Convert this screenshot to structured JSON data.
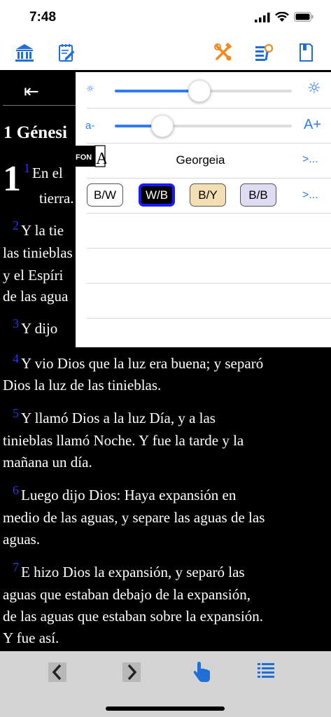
{
  "status": {
    "time": "7:48"
  },
  "toolbar": {
    "icons": [
      "library-icon",
      "notes-icon",
      "tools-icon",
      "search-text-icon",
      "bookmark-icon"
    ],
    "accent_blue": "#1f6fd6",
    "accent_orange": "#f08a1e"
  },
  "reader": {
    "back_glyph": "⇤",
    "book_title": "1 Génesi",
    "chapter_number": "1",
    "verses": [
      {
        "num": "1",
        "lines": [
          "En el",
          "tierra."
        ]
      },
      {
        "num": "2",
        "lines": [
          "Y la tie",
          "las tinieblas",
          "y el Espíri",
          "de las agua"
        ]
      },
      {
        "num": "3",
        "lines": [
          "Y dijo"
        ]
      },
      {
        "num": "4",
        "lines": [
          "Y vio Dios que la luz era buena; y separó",
          "Dios la luz de las tinieblas."
        ]
      },
      {
        "num": "5",
        "lines": [
          "Y llamó Dios a la luz Día, y a las",
          "tinieblas llamó Noche. Y fue la tarde y la",
          "mañana un día."
        ]
      },
      {
        "num": "6",
        "lines": [
          "Luego dijo Dios: Haya expansión en",
          "medio de las aguas, y separe las aguas de las",
          "aguas."
        ]
      },
      {
        "num": "7",
        "lines": [
          "E hizo Dios la expansión, y separó las",
          "aguas que estaban debajo de la expansión,",
          "de las aguas que estaban sobre la expansión.",
          "Y fue así."
        ]
      }
    ]
  },
  "settings": {
    "brightness": 0.48,
    "font_size": 0.27,
    "brightness_small_icon": "☼",
    "brightness_big_icon": "☼",
    "font_small_label": "a-",
    "font_big_label": "A+",
    "font_icon_text": "FON",
    "font_icon_letter": "A",
    "font_name": "Georgeia",
    "more_label": ">...",
    "themes": [
      {
        "label": "B/W",
        "bg": "#ffffff",
        "fg": "#000000",
        "border": "#555555"
      },
      {
        "label": "W/B",
        "bg": "#000000",
        "fg": "#ffffff",
        "border": "#1a1aff"
      },
      {
        "label": "B/Y",
        "bg": "#f4deb3",
        "fg": "#000000",
        "border": "#555555"
      },
      {
        "label": "B/B",
        "bg": "#dedcf3",
        "fg": "#000000",
        "border": "#555555"
      }
    ],
    "theme_more_label": ">..."
  },
  "bottom": {
    "icons": [
      "prev-chevron-icon",
      "next-chevron-icon",
      "tap-icon",
      "list-icon"
    ]
  }
}
